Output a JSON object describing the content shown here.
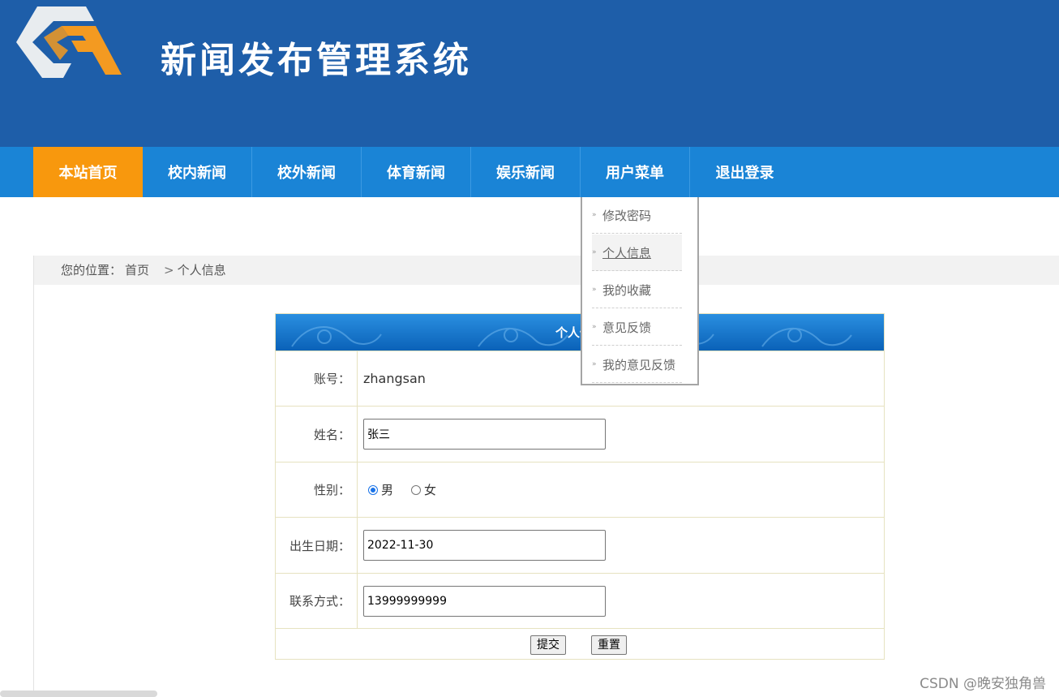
{
  "header": {
    "title": "新闻发布管理系统",
    "logo_icon": "g-hexagon-logo"
  },
  "nav": {
    "items": [
      {
        "label": "本站首页"
      },
      {
        "label": "校内新闻"
      },
      {
        "label": "校外新闻"
      },
      {
        "label": "体育新闻"
      },
      {
        "label": "娱乐新闻"
      },
      {
        "label": "用户菜单"
      },
      {
        "label": "退出登录"
      }
    ],
    "active_index": 0
  },
  "user_menu": {
    "items": [
      {
        "label": "修改密码"
      },
      {
        "label": "个人信息"
      },
      {
        "label": "我的收藏"
      },
      {
        "label": "意见反馈"
      },
      {
        "label": "我的意见反馈"
      }
    ]
  },
  "breadcrumb": {
    "prefix": "您的位置：",
    "home": "首页",
    "separator": ">",
    "current": "个人信息"
  },
  "form": {
    "title": "个人信息",
    "account_label": "账号：",
    "account_value": "zhangsan",
    "name_label": "姓名：",
    "name_value": "张三",
    "gender_label": "性别：",
    "gender_options": [
      {
        "label": "男",
        "checked": true
      },
      {
        "label": "女",
        "checked": false
      }
    ],
    "birth_label": "出生日期：",
    "birth_value": "2022-11-30",
    "phone_label": "联系方式：",
    "phone_value": "13999999999",
    "submit_label": "提交",
    "reset_label": "重置"
  },
  "watermark": "CSDN @晚安独角兽",
  "colors": {
    "header_bg": "#1e5ea9",
    "nav_bg": "#1a84d6",
    "active_nav": "#f8980d"
  }
}
